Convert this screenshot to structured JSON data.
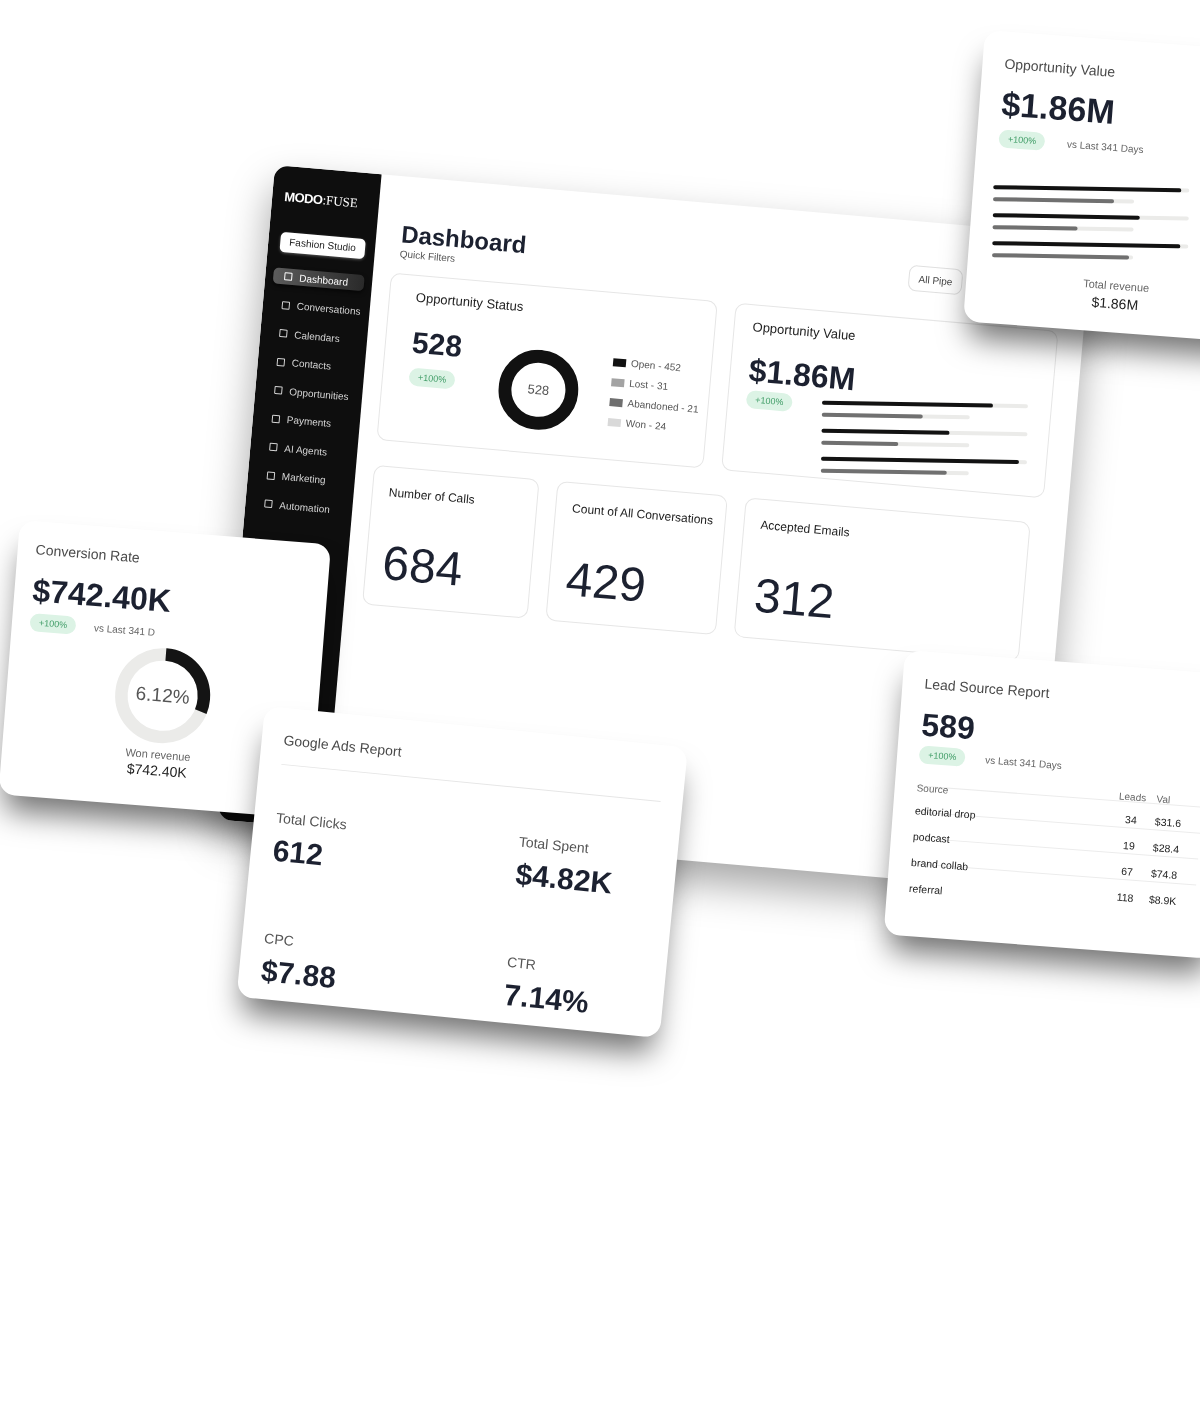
{
  "opportunity_value_card": {
    "title": "Opportunity Value",
    "value": "$1.86M",
    "change": "+100%",
    "comparison": "vs Last 341 Days",
    "bars": [
      {
        "kind": "primary",
        "level": 0.96
      },
      {
        "kind": "secondary",
        "level": 0.86
      },
      {
        "kind": "primary",
        "level": 0.75
      },
      {
        "kind": "secondary",
        "level": 0.6
      },
      {
        "kind": "primary",
        "level": 0.96
      },
      {
        "kind": "secondary",
        "level": 0.97
      }
    ],
    "total_label": "Total revenue",
    "total_value": "$1.86M"
  },
  "dashboard": {
    "sidebar": {
      "logo": {
        "mark": "MODO",
        "word": ":FUSE"
      },
      "workspace": "Fashion Studio",
      "items": [
        {
          "label": "Dashboard",
          "selected": true
        },
        {
          "label": "Conversations",
          "selected": false
        },
        {
          "label": "Calendars",
          "selected": false
        },
        {
          "label": "Contacts",
          "selected": false
        },
        {
          "label": "Opportunities",
          "selected": false
        },
        {
          "label": "Payments",
          "selected": false
        },
        {
          "label": "AI Agents",
          "selected": false
        },
        {
          "label": "Marketing",
          "selected": false
        },
        {
          "label": "Automation",
          "selected": false
        }
      ]
    },
    "header": {
      "title": "Dashboard",
      "subtitle": "Quick Filters",
      "filter_button": "All Pipe"
    },
    "opportunity_status": {
      "title": "Opportunity Status",
      "value": "528",
      "change": "+100%",
      "donut_total": "528",
      "legend": [
        {
          "label": "Open - 452",
          "color": "#111111"
        },
        {
          "label": "Lost - 31",
          "color": "#a3a3a3"
        },
        {
          "label": "Abandoned - 21",
          "color": "#6f6f6f"
        },
        {
          "label": "Won - 24",
          "color": "#d9d9d9"
        }
      ]
    },
    "opportunity_value": {
      "title": "Opportunity Value",
      "value": "$1.86M",
      "change": "+100%",
      "bars": [
        {
          "kind": "primary",
          "level": 0.83
        },
        {
          "kind": "secondary",
          "level": 0.68
        },
        {
          "kind": "primary",
          "level": 0.62
        },
        {
          "kind": "secondary",
          "level": 0.52
        },
        {
          "kind": "primary",
          "level": 0.96
        },
        {
          "kind": "secondary",
          "level": 0.85
        }
      ]
    },
    "stats": [
      {
        "title": "Number of Calls",
        "value": "684"
      },
      {
        "title": "Count of All Conversations",
        "value": "429"
      },
      {
        "title": "Accepted Emails",
        "value": "312"
      }
    ]
  },
  "conversion_rate_card": {
    "title": "Conversion Rate",
    "value": "$742.40K",
    "change": "+100%",
    "comparison": "vs Last 341 D",
    "ring": {
      "level": 0.3,
      "reading": "6.12%"
    },
    "total_label": "Won revenue",
    "total_value": "$742.40K"
  },
  "google_ads_card": {
    "title": "Google Ads Report",
    "metrics": [
      {
        "label": "Total Clicks",
        "value": "612"
      },
      {
        "label": "Total Spent",
        "value": "$4.82K"
      },
      {
        "label": "CPC",
        "value": "$7.88"
      },
      {
        "label": "CTR",
        "value": "7.14%"
      }
    ]
  },
  "lead_source_card": {
    "title": "Lead Source Report",
    "value": "589",
    "change": "+100%",
    "comparison": "vs Last 341 Days",
    "table": {
      "columns": [
        "Source",
        "Leads",
        "Val"
      ],
      "rows": [
        [
          "editorial drop",
          "34",
          "$31.6"
        ],
        [
          "podcast",
          "19",
          "$28.4"
        ],
        [
          "brand collab",
          "67",
          "$74.8"
        ],
        [
          "referral",
          "118",
          "$8.9K"
        ]
      ]
    }
  }
}
